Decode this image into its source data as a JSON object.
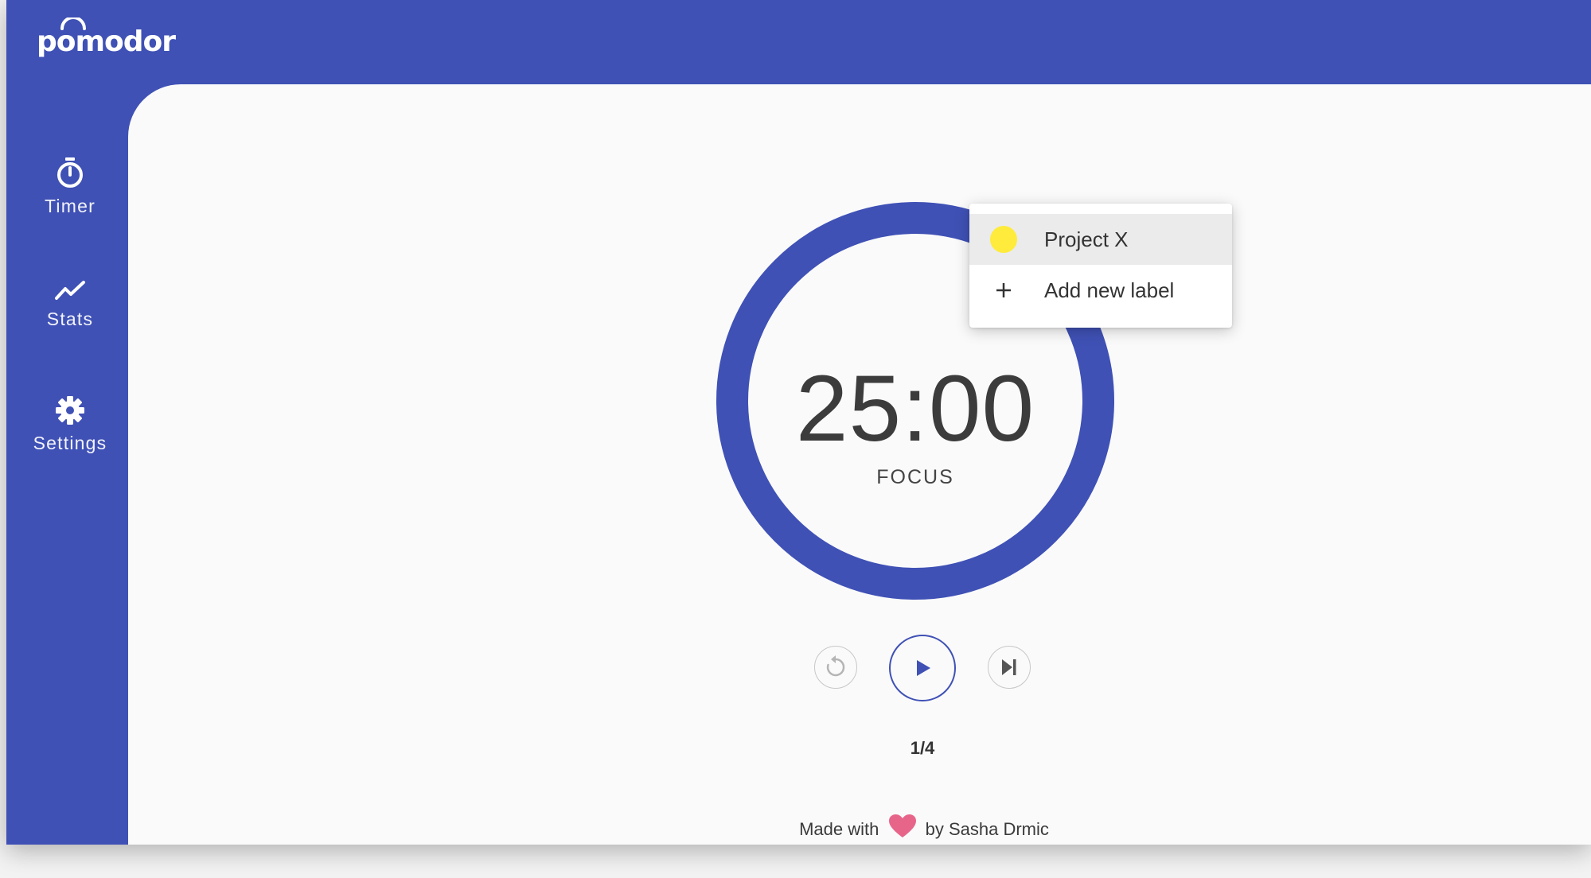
{
  "app": {
    "logo_text": "pomodor"
  },
  "sidebar": {
    "items": [
      {
        "label": "Timer",
        "icon": "stopwatch-icon"
      },
      {
        "label": "Stats",
        "icon": "trend-line-icon"
      },
      {
        "label": "Settings",
        "icon": "gear-icon"
      }
    ]
  },
  "timer": {
    "time": "25:00",
    "mode": "FOCUS",
    "round": "1/4",
    "progress_fraction": 1.0
  },
  "controls": {
    "reset_icon": "restart-icon",
    "play_icon": "play-icon",
    "skip_icon": "skip-next-icon"
  },
  "label_menu": {
    "items": [
      {
        "label": "Project X",
        "color": "#ffeb3b",
        "selected": true
      },
      {
        "label": "Add new label",
        "icon": "plus-icon"
      }
    ]
  },
  "footer": {
    "made_with": "Made with",
    "heart_icon": "heart-icon",
    "by": "by Sasha Drmic"
  },
  "colors": {
    "primary": "#3f51b5",
    "heart": "#e8658a",
    "content_bg": "#fafafa"
  }
}
